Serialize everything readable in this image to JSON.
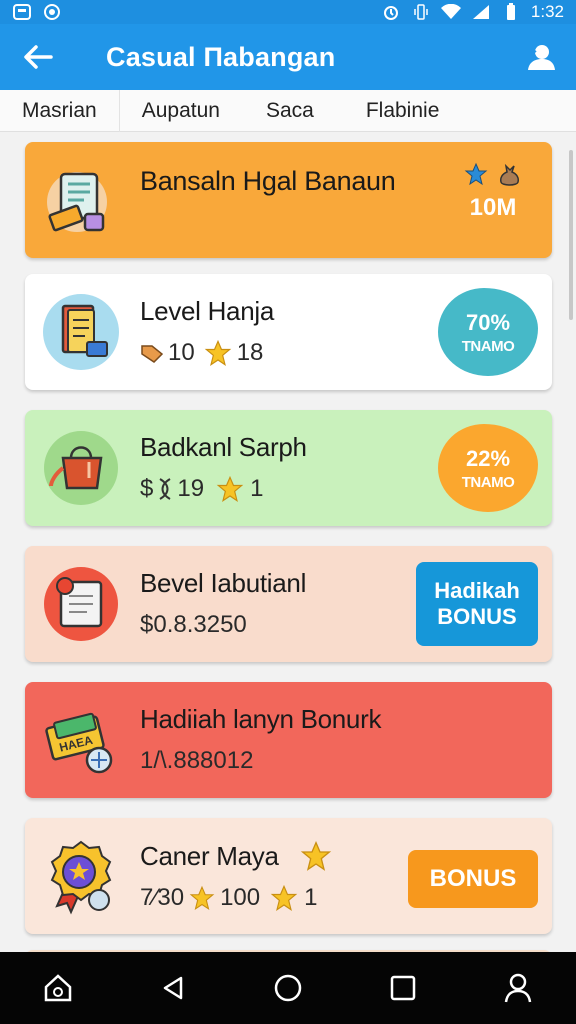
{
  "status": {
    "time": "1:32"
  },
  "appbar": {
    "title": "Casual Пabangan"
  },
  "tabs": [
    {
      "label": "Masrian"
    },
    {
      "label": "Aupatun"
    },
    {
      "label": "Saca"
    },
    {
      "label": "Flabinie"
    }
  ],
  "cards": [
    {
      "name": "Bansaln Hgal Banaun",
      "value": "10M",
      "bg": "#f9a83a",
      "icon": "ticket-icon"
    },
    {
      "name": "Level Hanja",
      "sub_a": "10",
      "sub_b": "18",
      "badge_pct": "70%",
      "badge_lbl": "TNAMO",
      "badge_color": "#46b9c8",
      "bg": "#ffffff",
      "icon": "document-icon"
    },
    {
      "name": "Badkanl Sarph",
      "sub_prefix": "$",
      "sub_a": "19",
      "sub_b": "1",
      "badge_pct": "22%",
      "badge_lbl": "TNAMO",
      "badge_color": "#fba72e",
      "bg": "#c9f1bc",
      "icon": "shopping-bag-icon"
    },
    {
      "name": "Bevel Iabutianl",
      "sub_text": "$0.8.3250",
      "button": "Hadikah BONUS",
      "button_line1": "Hadikah",
      "button_line2": "BONUS",
      "button_color": "#1697d9",
      "bg": "#f9dccc",
      "icon": "notebook-icon"
    },
    {
      "name": "Hadiiah lanyn Bonurk",
      "sub_text": "1/\\.888012",
      "bg": "#f2675b",
      "icon": "cash-icon"
    },
    {
      "name": "Caner Maya",
      "sub_text": "7⁄30",
      "sub_b": "100",
      "sub_c": "1",
      "button": "BONUS",
      "button_color": "#f7981d",
      "bg": "#fae6da",
      "icon": "medal-icon"
    }
  ],
  "colors": {
    "appbar": "#2196e8",
    "statusbar": "#1e8fe0",
    "navbar": "#050505"
  }
}
